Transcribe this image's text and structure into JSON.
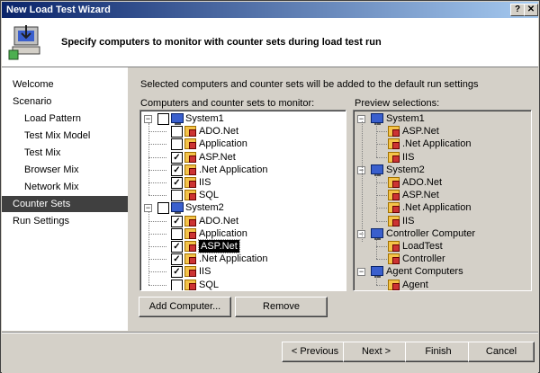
{
  "window": {
    "title": "New Load Test Wizard",
    "help_glyph": "?",
    "close_glyph": "✕"
  },
  "header": {
    "heading": "Specify computers to monitor with counter sets during load test run",
    "icon": "wizard-computer-icon"
  },
  "nav": {
    "items": [
      {
        "label": "Welcome",
        "level": 0,
        "selected": false
      },
      {
        "label": "Scenario",
        "level": 0,
        "selected": false
      },
      {
        "label": "Load Pattern",
        "level": 1,
        "selected": false
      },
      {
        "label": "Test Mix Model",
        "level": 1,
        "selected": false
      },
      {
        "label": "Test Mix",
        "level": 1,
        "selected": false
      },
      {
        "label": "Browser Mix",
        "level": 1,
        "selected": false
      },
      {
        "label": "Network Mix",
        "level": 1,
        "selected": false
      },
      {
        "label": "Counter Sets",
        "level": 0,
        "selected": true
      },
      {
        "label": "Run Settings",
        "level": 0,
        "selected": false
      }
    ]
  },
  "main": {
    "description": "Selected computers and counter sets will be added to the default run settings",
    "left_label": "Computers and counter sets to monitor:",
    "right_label": "Preview selections:",
    "tree": [
      {
        "label": "System1",
        "type": "computer",
        "checked": false,
        "children": [
          {
            "label": "ADO.Net",
            "checked": false
          },
          {
            "label": "Application",
            "checked": false
          },
          {
            "label": "ASP.Net",
            "checked": true
          },
          {
            "label": ".Net Application",
            "checked": true
          },
          {
            "label": "IIS",
            "checked": true
          },
          {
            "label": "SQL",
            "checked": false
          }
        ]
      },
      {
        "label": "System2",
        "type": "computer",
        "checked": false,
        "children": [
          {
            "label": "ADO.Net",
            "checked": true
          },
          {
            "label": "Application",
            "checked": false
          },
          {
            "label": "ASP.Net",
            "checked": true,
            "selected": true
          },
          {
            "label": ".Net Application",
            "checked": true
          },
          {
            "label": "IIS",
            "checked": true
          },
          {
            "label": "SQL",
            "checked": false
          }
        ]
      }
    ],
    "preview": [
      {
        "label": "System1",
        "children": [
          "ASP.Net",
          ".Net Application",
          "IIS"
        ]
      },
      {
        "label": "System2",
        "children": [
          "ADO.Net",
          "ASP.Net",
          ".Net Application",
          "IIS"
        ]
      },
      {
        "label": "Controller Computer",
        "children": [
          "LoadTest",
          "Controller"
        ]
      },
      {
        "label": "Agent Computers",
        "children": [
          "Agent"
        ]
      }
    ],
    "add_button": "Add Computer...",
    "remove_button": "Remove"
  },
  "footer": {
    "previous": "< Previous",
    "next": "Next >",
    "finish": "Finish",
    "cancel": "Cancel"
  },
  "colors": {
    "titlebar_start": "#0a246a",
    "titlebar_end": "#a6caf0",
    "selection": "#404040"
  }
}
